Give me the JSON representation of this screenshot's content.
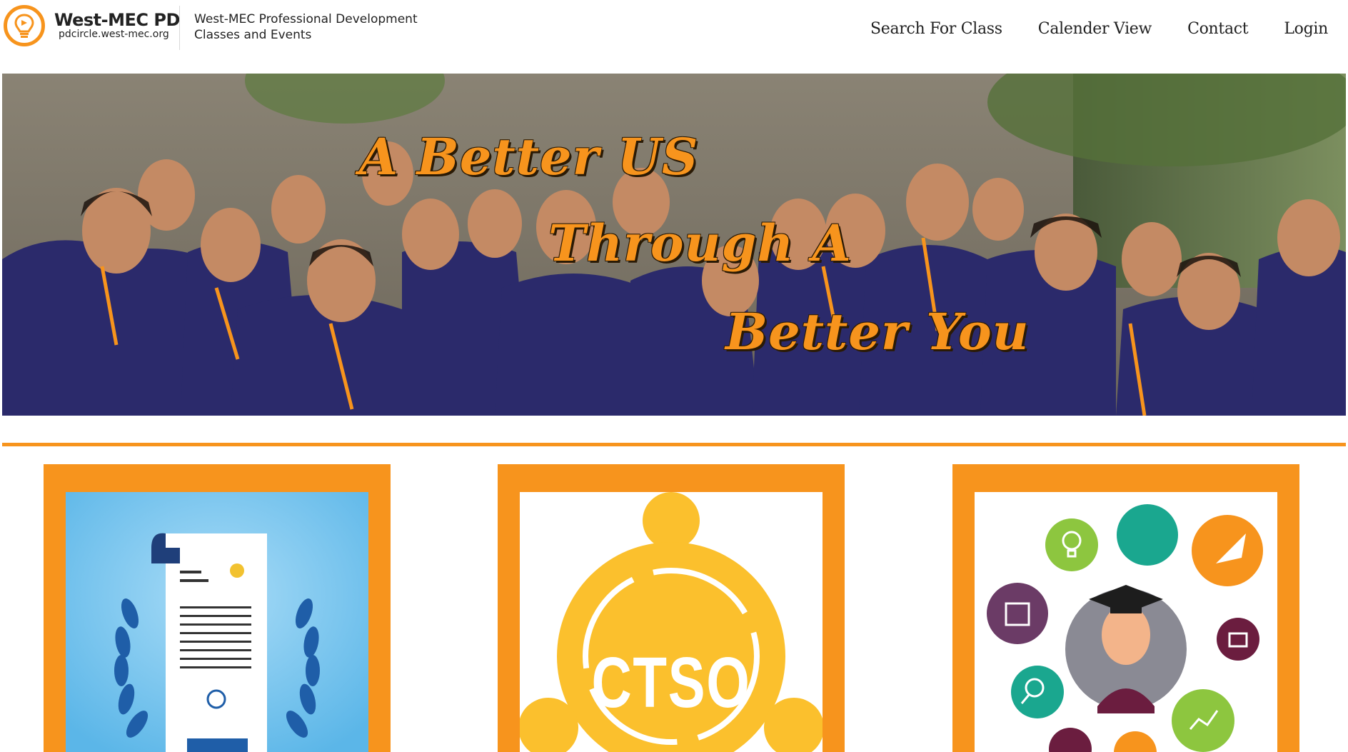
{
  "header": {
    "brand_name": "West-MEC PD",
    "brand_url": "pdcircle.west-mec.org",
    "tagline_line1": "West-MEC Professional Development",
    "tagline_line2": "Classes and Events"
  },
  "nav": {
    "items": [
      {
        "label": "Search For Class"
      },
      {
        "label": "Calender View"
      },
      {
        "label": "Contact"
      },
      {
        "label": "Login"
      }
    ]
  },
  "hero": {
    "line1": "A Better US",
    "line2": "Through A",
    "line3": "Better You"
  },
  "cards": [
    {
      "name": "certificate"
    },
    {
      "name": "ctso",
      "label": "CTSO"
    },
    {
      "name": "career-skills"
    }
  ],
  "colors": {
    "accent": "#f7941d",
    "scrubs": "#2b2a6b",
    "ctso_yellow": "#fbc02d",
    "cert_blue": "#5bb6e8"
  }
}
